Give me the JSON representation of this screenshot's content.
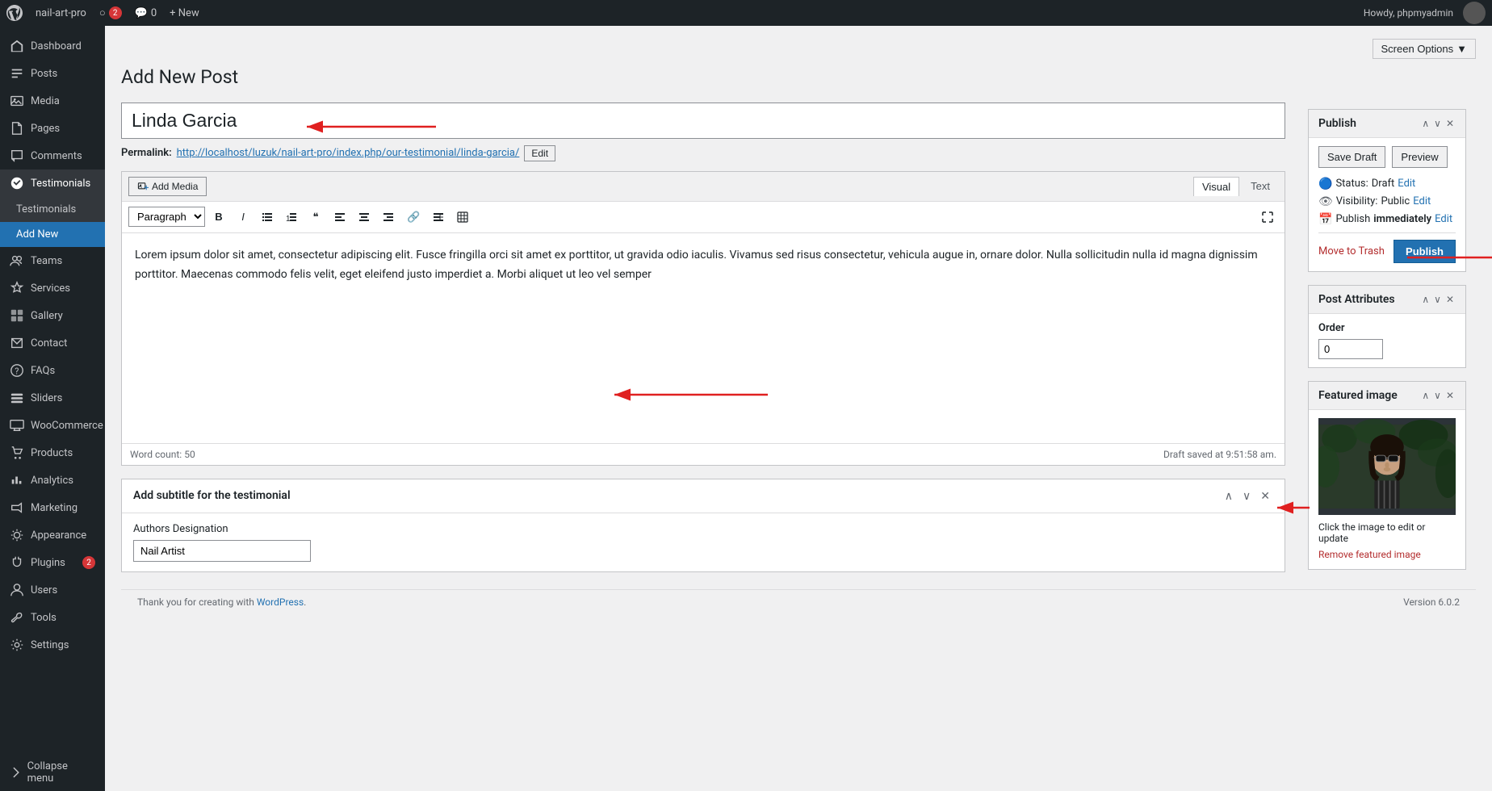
{
  "topbar": {
    "site_name": "nail-art-pro",
    "updates_count": "2",
    "comments_count": "0",
    "new_label": "+ New",
    "howdy": "Howdy, phpmyadmin",
    "screen_options": "Screen Options"
  },
  "sidebar": {
    "dashboard": "Dashboard",
    "posts": "Posts",
    "media": "Media",
    "pages": "Pages",
    "comments": "Comments",
    "testimonials": "Testimonials",
    "testimonials_sub": "Testimonials",
    "add_new_sub": "Add New",
    "teams": "Teams",
    "services": "Services",
    "gallery": "Gallery",
    "contact": "Contact",
    "faqs": "FAQs",
    "sliders": "Sliders",
    "woocommerce": "WooCommerce",
    "products": "Products",
    "analytics": "Analytics",
    "marketing": "Marketing",
    "appearance": "Appearance",
    "plugins": "Plugins",
    "plugins_badge": "2",
    "users": "Users",
    "tools": "Tools",
    "settings": "Settings",
    "collapse": "Collapse menu"
  },
  "page": {
    "title": "Add New Post"
  },
  "post": {
    "title": "Linda Garcia",
    "permalink_label": "Permalink:",
    "permalink_url": "http://localhost/luzuk/nail-art-pro/index.php/our-testimonial/linda-garcia/",
    "permalink_edit": "Edit",
    "content": "Lorem ipsum dolor sit amet, consectetur adipiscing elit. Fusce fringilla orci sit amet ex porttitor, ut gravida odio iaculis. Vivamus sed risus consectetur, vehicula augue in, ornare dolor. Nulla sollicitudin nulla id magna dignissim porttitor. Maecenas commodo felis velit, eget eleifend justo imperdiet a. Morbi aliquet ut leo vel semper",
    "word_count_label": "Word count:",
    "word_count": "50",
    "draft_saved": "Draft saved at 9:51:58 am."
  },
  "editor": {
    "add_media": "Add Media",
    "visual_tab": "Visual",
    "text_tab": "Text",
    "format_select": "Paragraph",
    "toolbar_buttons": [
      "B",
      "I",
      "≡",
      "≡",
      "❝",
      "≡",
      "≡",
      "≡",
      "🔗",
      "≡",
      "⊞"
    ]
  },
  "subtitle_box": {
    "title": "Add subtitle for the testimonial",
    "label": "Authors Designation",
    "value": "Nail Artist"
  },
  "publish_box": {
    "title": "Publish",
    "save_draft": "Save Draft",
    "preview": "Preview",
    "status_label": "Status:",
    "status_value": "Draft",
    "status_edit": "Edit",
    "visibility_label": "Visibility:",
    "visibility_value": "Public",
    "visibility_edit": "Edit",
    "publish_label": "Publish",
    "publish_value": "immediately",
    "publish_edit": "Edit",
    "move_to_trash": "Move to Trash",
    "publish_btn": "Publish"
  },
  "post_attributes": {
    "title": "Post Attributes",
    "order_label": "Order",
    "order_value": "0"
  },
  "featured_image": {
    "title": "Featured image",
    "caption": "Click the image to edit or update",
    "remove_link": "Remove featured image"
  },
  "footer": {
    "thank_you": "Thank you for creating with",
    "wordpress": "WordPress",
    "version": "Version 6.0.2"
  }
}
